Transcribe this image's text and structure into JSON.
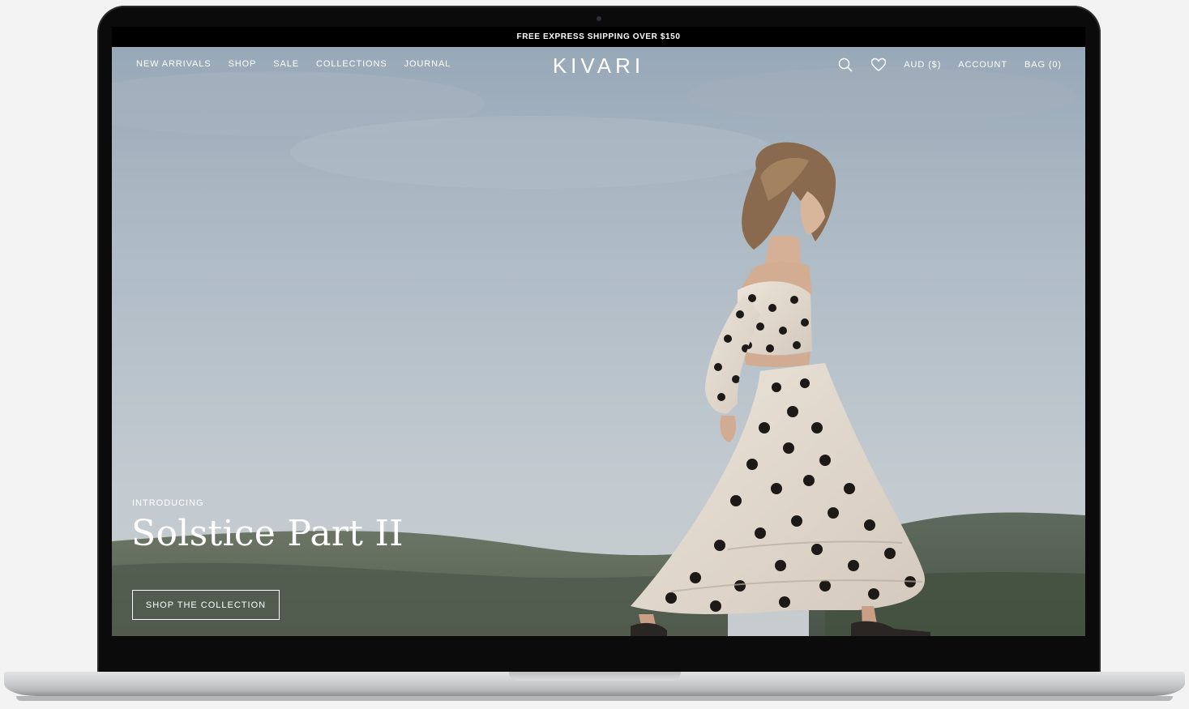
{
  "announcement": "FREE EXPRESS SHIPPING OVER $150",
  "nav": {
    "left": [
      "NEW ARRIVALS",
      "SHOP",
      "SALE",
      "COLLECTIONS",
      "JOURNAL"
    ],
    "logo": "KIVARI",
    "currency": "AUD ($)",
    "account": "ACCOUNT",
    "bag": "BAG (0)",
    "icons": [
      "search-icon",
      "heart-icon"
    ]
  },
  "hero": {
    "eyebrow": "INTRODUCING",
    "title": "Solstice Part II",
    "cta": "SHOP THE COLLECTION"
  },
  "colors": {
    "announcement_bg": "#000000",
    "text_on_hero": "#ffffff",
    "bezel": "#0b0b0c"
  }
}
